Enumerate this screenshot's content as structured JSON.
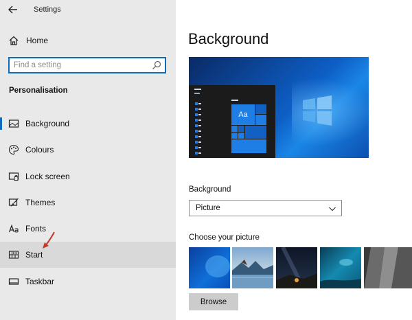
{
  "window": {
    "title": "Settings"
  },
  "sidebar": {
    "home_label": "Home",
    "search_placeholder": "Find a setting",
    "section_title": "Personalisation",
    "items": [
      {
        "label": "Background",
        "icon": "picture-icon",
        "selected": true
      },
      {
        "label": "Colours",
        "icon": "palette-icon",
        "selected": false
      },
      {
        "label": "Lock screen",
        "icon": "lock-screen-icon",
        "selected": false
      },
      {
        "label": "Themes",
        "icon": "themes-brush-icon",
        "selected": false
      },
      {
        "label": "Fonts",
        "icon": "fonts-icon",
        "selected": false
      },
      {
        "label": "Start",
        "icon": "start-grid-icon",
        "selected": false,
        "hovered": true
      },
      {
        "label": "Taskbar",
        "icon": "taskbar-icon",
        "selected": false
      }
    ]
  },
  "main": {
    "page_title": "Background",
    "preview_tile_text": "Aa",
    "background_label": "Background",
    "background_value": "Picture",
    "choose_label": "Choose your picture",
    "browse_label": "Browse"
  },
  "colors": {
    "accent": "#0f6cbd",
    "sidebar_bg": "#e9e9e9",
    "hover_bg": "#d9d9d9",
    "annotation_arrow": "#c0392b"
  }
}
